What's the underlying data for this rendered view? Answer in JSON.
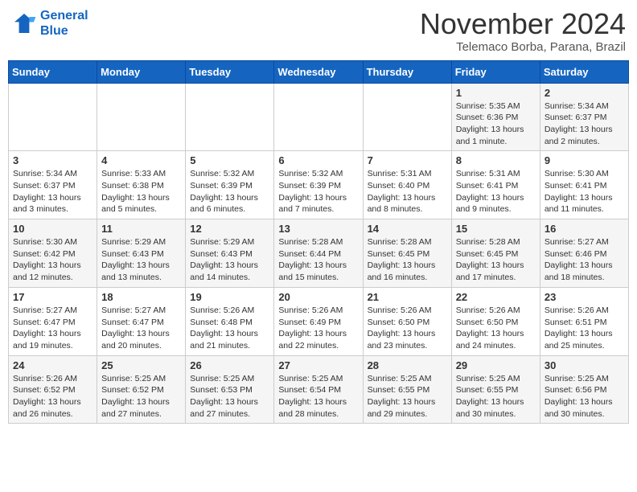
{
  "logo": {
    "line1": "General",
    "line2": "Blue"
  },
  "title": "November 2024",
  "subtitle": "Telemaco Borba, Parana, Brazil",
  "weekdays": [
    "Sunday",
    "Monday",
    "Tuesday",
    "Wednesday",
    "Thursday",
    "Friday",
    "Saturday"
  ],
  "weeks": [
    [
      {
        "day": "",
        "info": ""
      },
      {
        "day": "",
        "info": ""
      },
      {
        "day": "",
        "info": ""
      },
      {
        "day": "",
        "info": ""
      },
      {
        "day": "",
        "info": ""
      },
      {
        "day": "1",
        "info": "Sunrise: 5:35 AM\nSunset: 6:36 PM\nDaylight: 13 hours and 1 minute."
      },
      {
        "day": "2",
        "info": "Sunrise: 5:34 AM\nSunset: 6:37 PM\nDaylight: 13 hours and 2 minutes."
      }
    ],
    [
      {
        "day": "3",
        "info": "Sunrise: 5:34 AM\nSunset: 6:37 PM\nDaylight: 13 hours and 3 minutes."
      },
      {
        "day": "4",
        "info": "Sunrise: 5:33 AM\nSunset: 6:38 PM\nDaylight: 13 hours and 5 minutes."
      },
      {
        "day": "5",
        "info": "Sunrise: 5:32 AM\nSunset: 6:39 PM\nDaylight: 13 hours and 6 minutes."
      },
      {
        "day": "6",
        "info": "Sunrise: 5:32 AM\nSunset: 6:39 PM\nDaylight: 13 hours and 7 minutes."
      },
      {
        "day": "7",
        "info": "Sunrise: 5:31 AM\nSunset: 6:40 PM\nDaylight: 13 hours and 8 minutes."
      },
      {
        "day": "8",
        "info": "Sunrise: 5:31 AM\nSunset: 6:41 PM\nDaylight: 13 hours and 9 minutes."
      },
      {
        "day": "9",
        "info": "Sunrise: 5:30 AM\nSunset: 6:41 PM\nDaylight: 13 hours and 11 minutes."
      }
    ],
    [
      {
        "day": "10",
        "info": "Sunrise: 5:30 AM\nSunset: 6:42 PM\nDaylight: 13 hours and 12 minutes."
      },
      {
        "day": "11",
        "info": "Sunrise: 5:29 AM\nSunset: 6:43 PM\nDaylight: 13 hours and 13 minutes."
      },
      {
        "day": "12",
        "info": "Sunrise: 5:29 AM\nSunset: 6:43 PM\nDaylight: 13 hours and 14 minutes."
      },
      {
        "day": "13",
        "info": "Sunrise: 5:28 AM\nSunset: 6:44 PM\nDaylight: 13 hours and 15 minutes."
      },
      {
        "day": "14",
        "info": "Sunrise: 5:28 AM\nSunset: 6:45 PM\nDaylight: 13 hours and 16 minutes."
      },
      {
        "day": "15",
        "info": "Sunrise: 5:28 AM\nSunset: 6:45 PM\nDaylight: 13 hours and 17 minutes."
      },
      {
        "day": "16",
        "info": "Sunrise: 5:27 AM\nSunset: 6:46 PM\nDaylight: 13 hours and 18 minutes."
      }
    ],
    [
      {
        "day": "17",
        "info": "Sunrise: 5:27 AM\nSunset: 6:47 PM\nDaylight: 13 hours and 19 minutes."
      },
      {
        "day": "18",
        "info": "Sunrise: 5:27 AM\nSunset: 6:47 PM\nDaylight: 13 hours and 20 minutes."
      },
      {
        "day": "19",
        "info": "Sunrise: 5:26 AM\nSunset: 6:48 PM\nDaylight: 13 hours and 21 minutes."
      },
      {
        "day": "20",
        "info": "Sunrise: 5:26 AM\nSunset: 6:49 PM\nDaylight: 13 hours and 22 minutes."
      },
      {
        "day": "21",
        "info": "Sunrise: 5:26 AM\nSunset: 6:50 PM\nDaylight: 13 hours and 23 minutes."
      },
      {
        "day": "22",
        "info": "Sunrise: 5:26 AM\nSunset: 6:50 PM\nDaylight: 13 hours and 24 minutes."
      },
      {
        "day": "23",
        "info": "Sunrise: 5:26 AM\nSunset: 6:51 PM\nDaylight: 13 hours and 25 minutes."
      }
    ],
    [
      {
        "day": "24",
        "info": "Sunrise: 5:26 AM\nSunset: 6:52 PM\nDaylight: 13 hours and 26 minutes."
      },
      {
        "day": "25",
        "info": "Sunrise: 5:25 AM\nSunset: 6:52 PM\nDaylight: 13 hours and 27 minutes."
      },
      {
        "day": "26",
        "info": "Sunrise: 5:25 AM\nSunset: 6:53 PM\nDaylight: 13 hours and 27 minutes."
      },
      {
        "day": "27",
        "info": "Sunrise: 5:25 AM\nSunset: 6:54 PM\nDaylight: 13 hours and 28 minutes."
      },
      {
        "day": "28",
        "info": "Sunrise: 5:25 AM\nSunset: 6:55 PM\nDaylight: 13 hours and 29 minutes."
      },
      {
        "day": "29",
        "info": "Sunrise: 5:25 AM\nSunset: 6:55 PM\nDaylight: 13 hours and 30 minutes."
      },
      {
        "day": "30",
        "info": "Sunrise: 5:25 AM\nSunset: 6:56 PM\nDaylight: 13 hours and 30 minutes."
      }
    ]
  ]
}
